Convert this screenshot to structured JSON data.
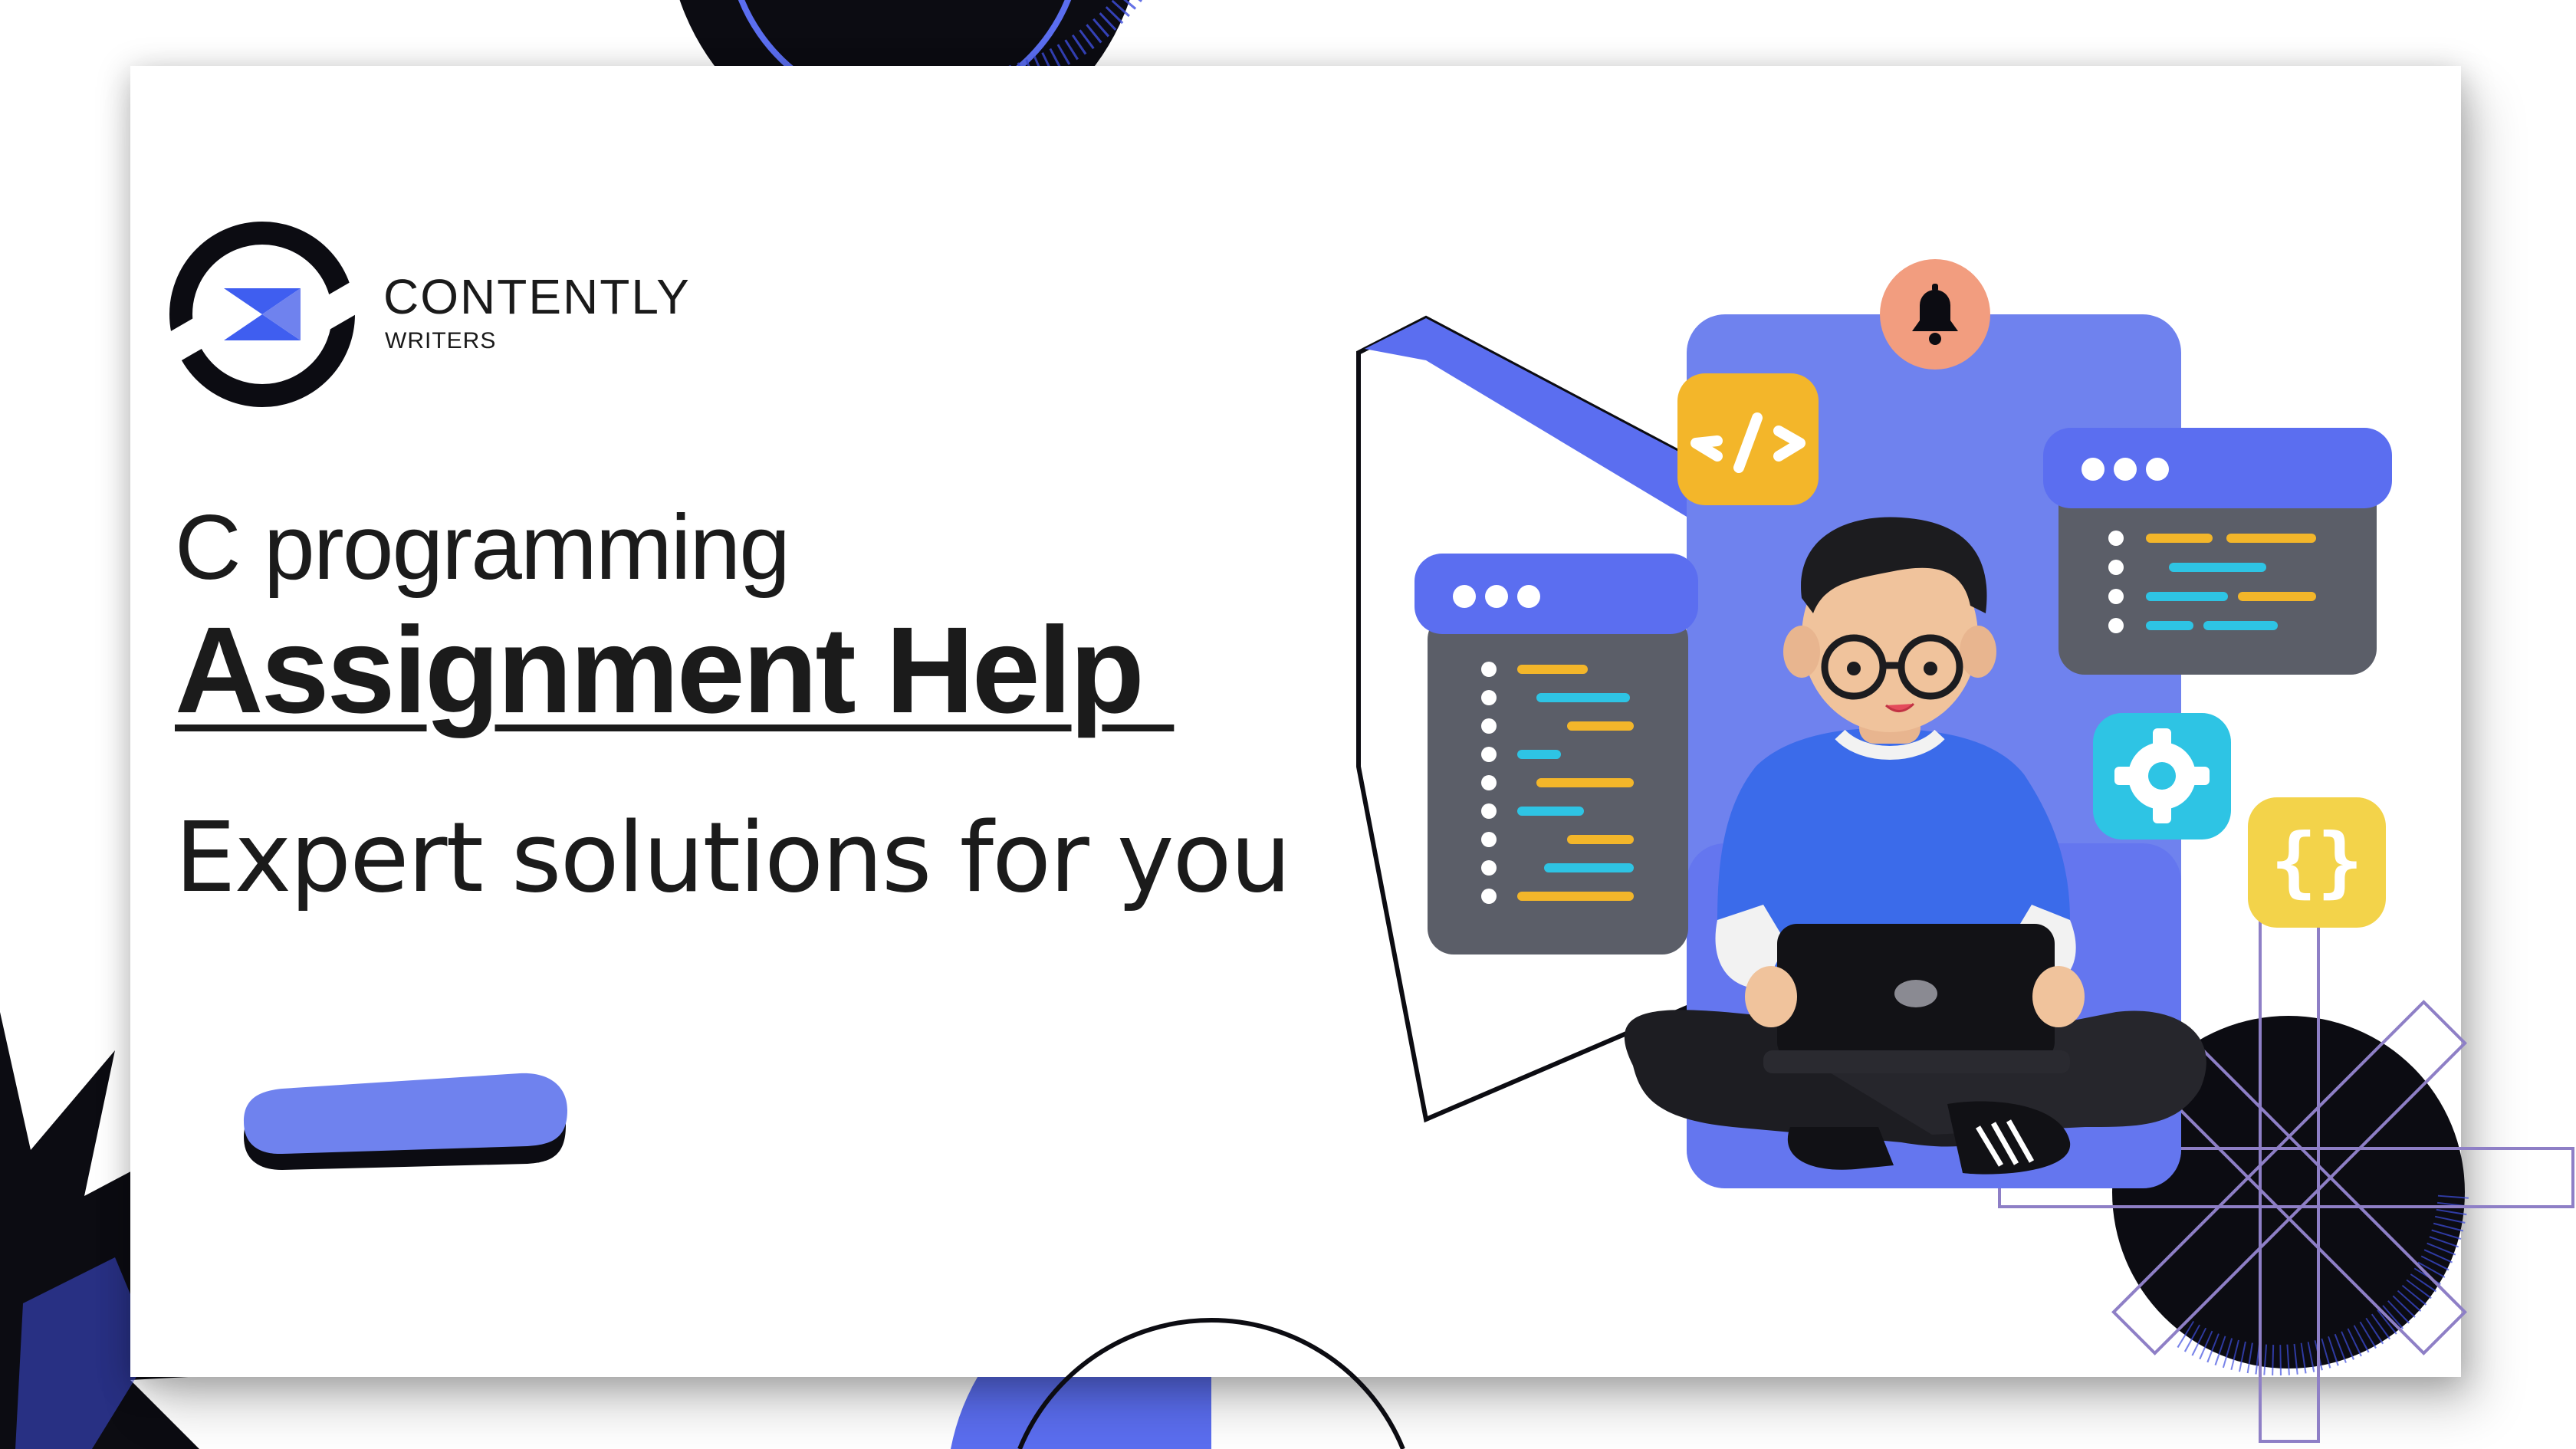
{
  "brand": {
    "name": "CONTENTLY",
    "sub": "WRITERS"
  },
  "headline": {
    "line1": "C programming",
    "line2": "Assignment Help ",
    "line3": "Expert solutions for you"
  },
  "colors": {
    "accent_blue": "#5b6ef0",
    "accent_blue_light": "#6f82ee",
    "dark": "#0c0c12",
    "code_yellow": "#f3b62a",
    "code_cyan": "#2ec4e4",
    "bell_orange": "#f29d7f",
    "panel_grey": "#5b5e68",
    "line_purple": "#8e7fc6"
  },
  "icons": {
    "logo": "contently-logo-icon",
    "code_tag": "code-tag-icon",
    "bell": "bell-icon",
    "gear": "gear-icon",
    "braces": "curly-braces-icon",
    "laptop": "laptop-icon"
  }
}
